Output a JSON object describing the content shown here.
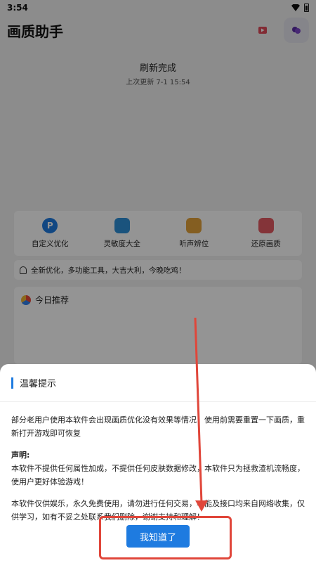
{
  "status_bar": {
    "time": "3:54"
  },
  "app_bar": {
    "title": "画质助手"
  },
  "refresh": {
    "title": "刷新完成",
    "subtitle": "上次更新 7-1 15:54"
  },
  "features": [
    {
      "label": "自定义优化",
      "icon": "custom-optimize-icon",
      "color": "#1e7be0"
    },
    {
      "label": "灵敏度大全",
      "icon": "sensitivity-icon",
      "color": "#2d8fd8"
    },
    {
      "label": "听声辨位",
      "icon": "sound-locate-icon",
      "color": "#e4a23a"
    },
    {
      "label": "还原画质",
      "icon": "restore-quality-icon",
      "color": "#e35b62"
    }
  ],
  "notice": {
    "text": "全新优化，多功能工具，大吉大利，今晚吃鸡！"
  },
  "recommend": {
    "title": "今日推荐"
  },
  "dialog": {
    "title": "温馨提示",
    "para1": "部分老用户使用本软件会出现画质优化没有效果等情况！使用前需要重置一下画质，重新打开游戏即可恢复",
    "decl_title": "声明:",
    "decl_text": "本软件不提供任何属性加成，不提供任何皮肤数据修改，本软件只为拯救渣机流畅度，使用户更好体验游戏！",
    "para3": "本软件仅供娱乐，永久免费使用，请勿进行任何交易，功能及接口均来自网络收集，仅供学习，如有不妥之处联系我们删除，谢谢支持和理解！",
    "confirm_label": "我知道了"
  },
  "colors": {
    "accent": "#1e7be0",
    "annotation": "#e0463a"
  }
}
